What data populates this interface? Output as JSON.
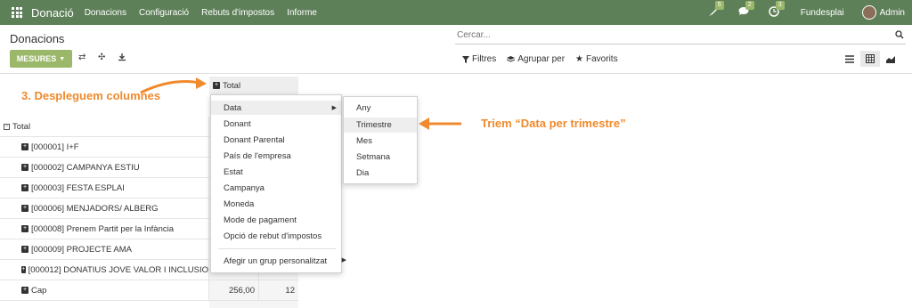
{
  "navbar": {
    "app_title": "Donació",
    "menu": [
      "Donacions",
      "Configuració",
      "Rebuts d'impostos",
      "Informe"
    ],
    "badges": {
      "activity": "5",
      "messages": "2",
      "clock": "3"
    },
    "company": "Fundesplai",
    "user": "Admin",
    "color": "#5e8059"
  },
  "control": {
    "breadcrumb": "Donacions",
    "search_placeholder": "Cercar...",
    "measures_label": "MESURES",
    "filters_label": "Filtres",
    "group_by_label": "Agrupar per",
    "favorites_label": "Favorits",
    "accent": "#9bb86a"
  },
  "pivot": {
    "column_header": "Total",
    "rows": [
      {
        "label": "Total",
        "kind": "total"
      },
      {
        "label": "[000001] I+F"
      },
      {
        "label": "[000002] CAMPANYA ESTIU"
      },
      {
        "label": "[000003] FESTA ESPLAI"
      },
      {
        "label": "[000006] MENJADORS/ ALBERG"
      },
      {
        "label": "[000008] Prenem Partit per la Infància"
      },
      {
        "label": "[000009] PROJECTE AMA"
      },
      {
        "label": "[000012] DONATIUS JOVE VALOR I INCLUSIO"
      },
      {
        "label": "Cap",
        "v1": "256,00",
        "v2": "12"
      }
    ]
  },
  "dropdown": {
    "items": [
      "Data",
      "Donant",
      "Donant Parental",
      "País de l'empresa",
      "Estat",
      "Campanya",
      "Moneda",
      "Mode de pagament",
      "Opció de rebut d'impostos"
    ],
    "custom_group": "Afegir un grup personalitzat"
  },
  "submenu": {
    "items": [
      "Any",
      "Trimestre",
      "Mes",
      "Setmana",
      "Dia"
    ]
  },
  "annotations": {
    "step": "3. Despleguem columnes",
    "choice": "Triem “Data per trimestre”",
    "color": "#f08a2c"
  }
}
